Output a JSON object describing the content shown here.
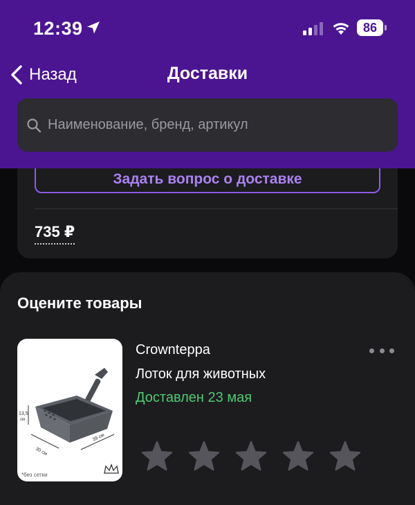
{
  "status_bar": {
    "time": "12:39",
    "battery": "86"
  },
  "nav": {
    "back_label": "Назад",
    "title": "Доставки"
  },
  "search": {
    "placeholder": "Наименование, бренд, артикул",
    "value": ""
  },
  "delivery_card": {
    "ask_button_label": "Задать вопрос о доставке",
    "price": "735 ₽"
  },
  "rate_section": {
    "title": "Оцените товары",
    "product": {
      "brand": "Crowntерра",
      "name": "Лоток для животных",
      "status": "Доставлен 23 мая",
      "image_labels": {
        "height": "13,5 см",
        "width": "30 см",
        "depth": "39 см",
        "note": "без сетки"
      }
    },
    "rating_max": 5,
    "rating_value": 0
  },
  "colors": {
    "header": "#4b1592",
    "accent": "#8f5be8",
    "success": "#4ecb71",
    "card": "#1c1c1f"
  },
  "icons": [
    "location-arrow-icon",
    "cellular-signal-icon",
    "wifi-icon",
    "battery-icon",
    "back-chevron-icon",
    "search-icon",
    "more-icon",
    "star-icon",
    "crown-icon"
  ]
}
